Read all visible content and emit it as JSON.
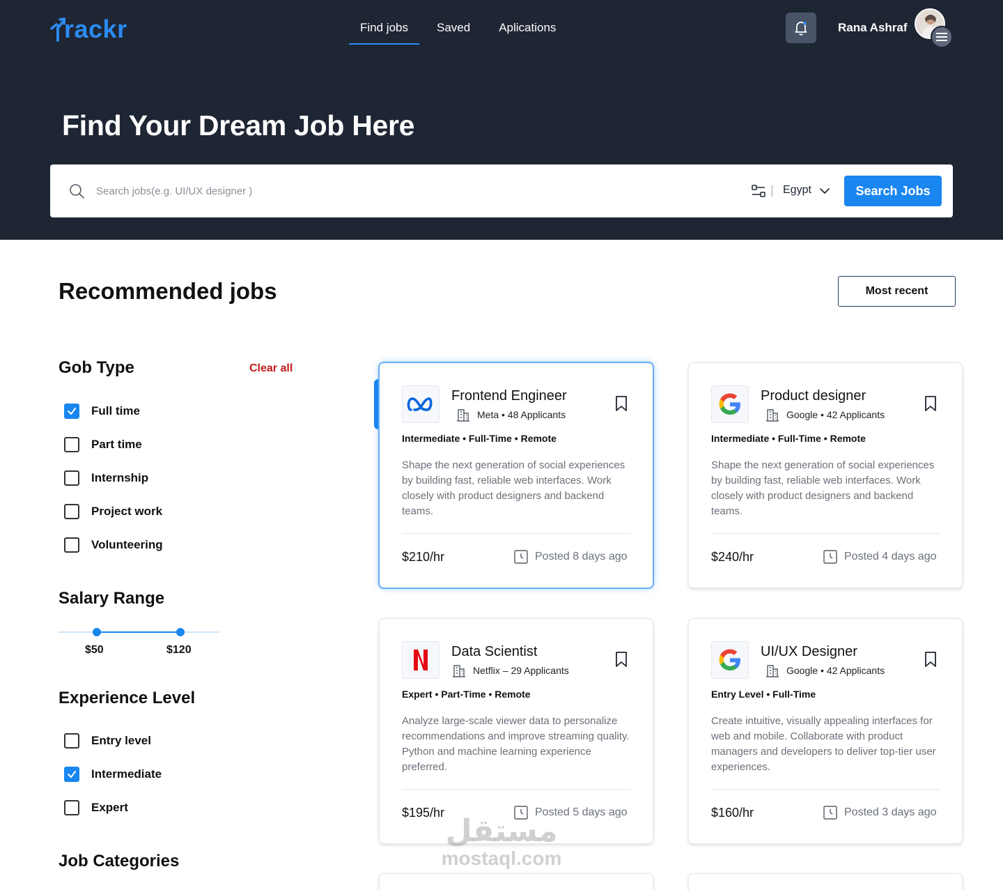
{
  "brand": {
    "name": "rackr"
  },
  "nav": {
    "items": [
      "Find jobs",
      "Saved",
      "Aplications"
    ],
    "active_index": 0
  },
  "user": {
    "name": "Rana Ashraf"
  },
  "hero": {
    "title": "Find Your Dream Job Here"
  },
  "search": {
    "placeholder": "Search jobs(e.g. UI/UX designer )",
    "value": "",
    "country": "Egypt",
    "button_label": "Search Jobs"
  },
  "section": {
    "title": "Recommended jobs",
    "sort_label": "Most recent"
  },
  "filters": {
    "job_type": {
      "title": "Gob Type",
      "clear_label": "Clear all",
      "options": [
        {
          "label": "Full time",
          "checked": true
        },
        {
          "label": "Part time",
          "checked": false
        },
        {
          "label": "Internship",
          "checked": false
        },
        {
          "label": "Project work",
          "checked": false
        },
        {
          "label": "Volunteering",
          "checked": false
        }
      ]
    },
    "salary": {
      "title": "Salary Range",
      "min_label": "$50",
      "max_label": "$120",
      "min": 50,
      "max": 120
    },
    "experience": {
      "title": "Experience Level",
      "options": [
        {
          "label": "Entry level",
          "checked": false
        },
        {
          "label": "Intermediate",
          "checked": true
        },
        {
          "label": "Expert",
          "checked": false
        }
      ]
    },
    "categories": {
      "title": "Job Categories"
    }
  },
  "jobs": [
    {
      "title": "Frontend Engineer",
      "company": "Meta • 48 Applicants",
      "logo": "meta-logo",
      "tags": "Intermediate • Full-Time • Remote",
      "description": "Shape the next generation of social experiences by building fast, reliable web interfaces. Work closely with product designers and backend teams.",
      "rate": "$210/hr",
      "posted": "Posted 8 days ago",
      "selected": true
    },
    {
      "title": "Product designer",
      "company": "Google • 42 Applicants",
      "logo": "google-logo",
      "tags": "Intermediate • Full-Time • Remote",
      "description": "Shape the next generation of social experiences by building fast, reliable web interfaces. Work closely with product designers and backend teams.",
      "rate": "$240/hr",
      "posted": "Posted 4 days ago",
      "selected": false
    },
    {
      "title": "Data Scientist",
      "company": "Netflix – 29 Applicants",
      "logo": "netflix-logo",
      "tags": "Expert • Part-Time • Remote",
      "description": "Analyze large-scale viewer data to personalize recommendations and improve streaming quality. Python and machine learning experience preferred.",
      "rate": "$195/hr",
      "posted": "Posted 5 days ago",
      "selected": false
    },
    {
      "title": "UI/UX Designer",
      "company": "Google • 42 Applicants",
      "logo": "google-logo",
      "tags": "Entry Level • Full-Time",
      "description": "Create intuitive, visually appealing interfaces for web and mobile. Collaborate with product managers and developers to deliver top-tier user experiences.",
      "rate": "$160/hr",
      "posted": "Posted 3 days ago",
      "selected": false
    }
  ],
  "watermark": {
    "arabic": "مستقل",
    "latin": "mostaql.com"
  },
  "colors": {
    "hero_bg": "#1e2533",
    "accent": "#1a86f0",
    "clear": "#c21a1a"
  }
}
